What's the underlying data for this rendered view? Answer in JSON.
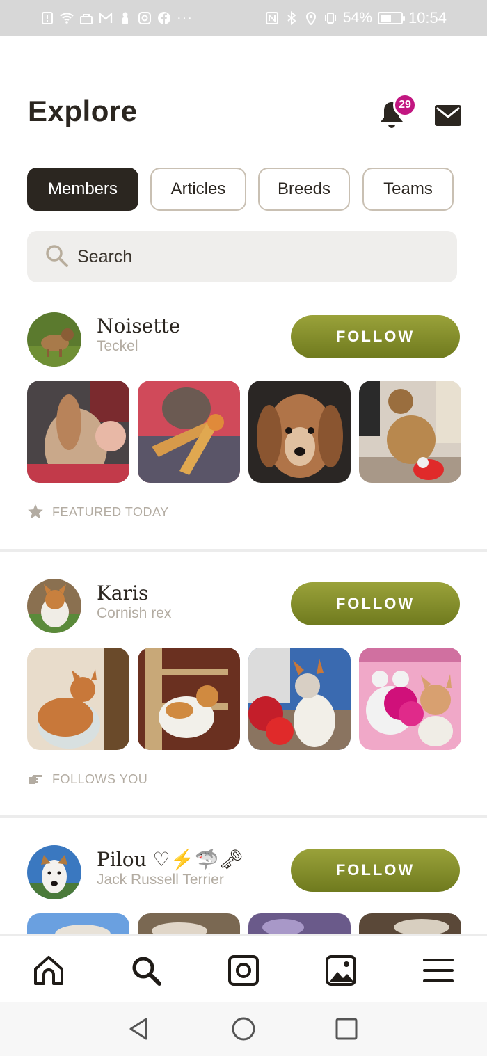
{
  "status_bar": {
    "battery": "54%",
    "battery_level": 0.54,
    "time": "10:54",
    "overflow": "···"
  },
  "header": {
    "title": "Explore",
    "notification_count": "29",
    "notification_icon": "bell-icon",
    "messages_icon": "mail-icon"
  },
  "tabs": [
    {
      "label": "Members",
      "active": true
    },
    {
      "label": "Articles",
      "active": false
    },
    {
      "label": "Breeds",
      "active": false
    },
    {
      "label": "Teams",
      "active": false
    }
  ],
  "search": {
    "placeholder": "Search"
  },
  "members": [
    {
      "name": "Noisette",
      "breed": "Teckel",
      "follow_label": "FOLLOW",
      "tag_icon": "star-icon",
      "tag_label": "FEATURED TODAY"
    },
    {
      "name": "Karis",
      "breed": "Cornish rex",
      "follow_label": "FOLLOW",
      "tag_icon": "pointing-hand-icon",
      "tag_label": "FOLLOWS YOU"
    },
    {
      "name": "Pilou ♡⚡🦈🗝",
      "breed": "Jack Russell Terrier",
      "follow_label": "FOLLOW"
    }
  ],
  "bottom_nav": [
    "home-icon",
    "search-icon",
    "camera-icon",
    "gallery-icon",
    "menu-icon"
  ],
  "system_nav": [
    "back-icon",
    "home-circle-icon",
    "recents-icon"
  ],
  "colors": {
    "accent": "#8a9430",
    "badge": "#c21781",
    "dark": "#2b2620",
    "muted": "#b3aca2"
  }
}
